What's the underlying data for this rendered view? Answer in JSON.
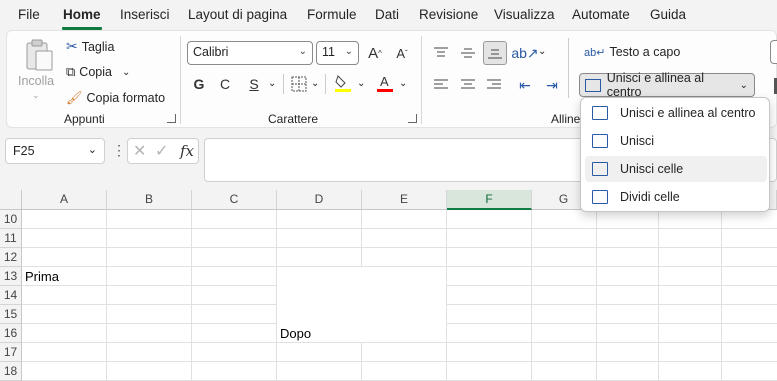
{
  "menu": {
    "items": [
      "File",
      "Home",
      "Inserisci",
      "Layout di pagina",
      "Formule",
      "Dati",
      "Revisione",
      "Visualizza",
      "Automate",
      "Guida"
    ],
    "active": "Home"
  },
  "clipboard": {
    "paste_label": "Incolla",
    "cut_label": "Taglia",
    "copy_label": "Copia",
    "format_painter_label": "Copia formato",
    "group_label": "Appunti"
  },
  "font": {
    "name": "Calibri",
    "size": "11",
    "bold": "G",
    "italic": "C",
    "underline": "S",
    "group_label": "Carattere",
    "fill_color": "#ffff00",
    "font_color": "#ff0000"
  },
  "alignment": {
    "wrap_label": "Testo a capo",
    "merge_label": "Unisci e allinea al centro",
    "group_label": "Allinea"
  },
  "merge_menu": {
    "items": [
      "Unisci e allinea al centro",
      "Unisci",
      "Unisci celle",
      "Dividi celle"
    ],
    "hovered_index": 2
  },
  "formula_bar": {
    "name_box": "F25",
    "fx_label": "fx",
    "formula": ""
  },
  "sheet": {
    "columns": [
      "A",
      "B",
      "C",
      "D",
      "E",
      "F",
      "G"
    ],
    "selected_column": "F",
    "rows": [
      "10",
      "11",
      "12",
      "13",
      "14",
      "15",
      "16",
      "17",
      "18"
    ],
    "cells": {
      "A13": "Prima",
      "D16": "Dopo"
    }
  },
  "colors": {
    "accent": "#107c41",
    "ribbon_bg": "#fdfdfd",
    "app_bg": "#f3f3f3"
  }
}
